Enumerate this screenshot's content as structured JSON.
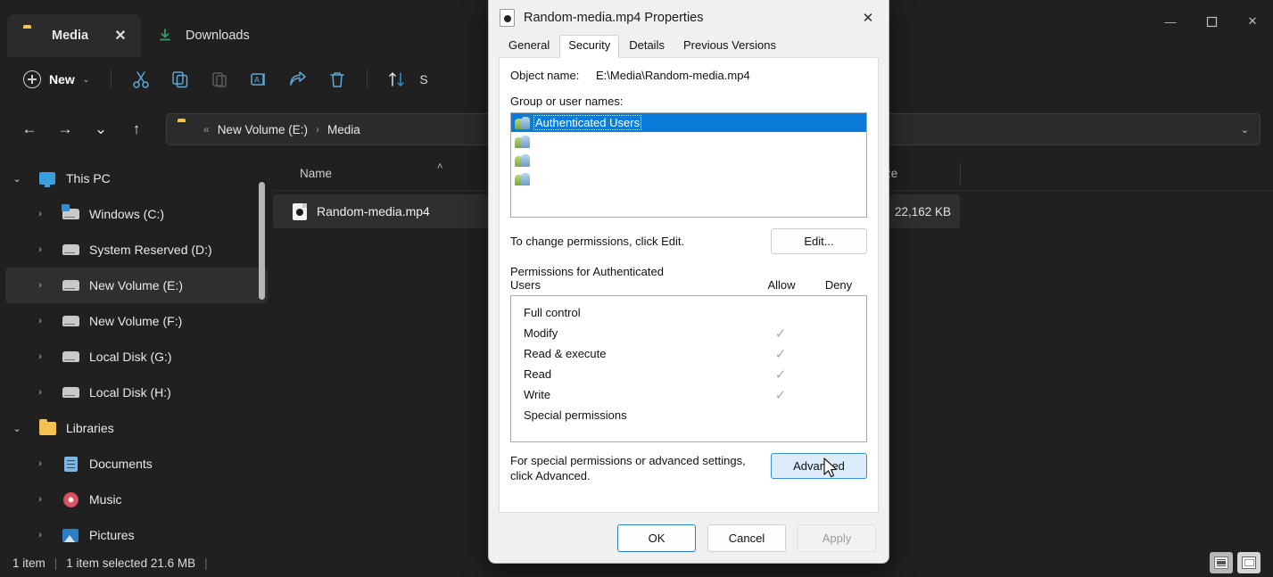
{
  "explorer": {
    "tabs": [
      {
        "label": "Media",
        "icon": "folder-icon",
        "active": true,
        "close": "✕"
      },
      {
        "label": "Downloads",
        "icon": "download-icon",
        "active": false
      }
    ],
    "window_controls": {
      "minimize": "—",
      "maximize": "❐",
      "close": "✕"
    },
    "toolbar": {
      "new_label": "New",
      "new_caret": "⌄",
      "sort_label": "S",
      "icons": [
        "cut-icon",
        "copy-icon",
        "paste-icon",
        "rename-icon",
        "share-icon",
        "delete-icon",
        "sort-icon"
      ]
    },
    "address": {
      "back": "←",
      "forward": "→",
      "recent": "⌄",
      "up": "↑",
      "chevrons": "«",
      "crumb1": "New Volume (E:)",
      "crumb_sep": "›",
      "crumb2": "Media",
      "dropdown": "⌄"
    },
    "nav": {
      "items": [
        {
          "label": "This PC",
          "icon": "pc-icon",
          "expanded": true,
          "indent": 0
        },
        {
          "label": "Windows (C:)",
          "icon": "drive-windows-icon",
          "expanded": false,
          "indent": 1
        },
        {
          "label": "System Reserved (D:)",
          "icon": "drive-icon",
          "expanded": false,
          "indent": 1
        },
        {
          "label": "New Volume (E:)",
          "icon": "drive-icon",
          "expanded": false,
          "indent": 1,
          "selected": true
        },
        {
          "label": "New Volume (F:)",
          "icon": "drive-icon",
          "expanded": false,
          "indent": 1
        },
        {
          "label": "Local Disk (G:)",
          "icon": "drive-icon",
          "expanded": false,
          "indent": 1
        },
        {
          "label": "Local Disk (H:)",
          "icon": "drive-icon",
          "expanded": false,
          "indent": 1
        },
        {
          "label": "Libraries",
          "icon": "folder-icon",
          "expanded": true,
          "indent": 0
        },
        {
          "label": "Documents",
          "icon": "documents-icon",
          "expanded": false,
          "indent": 1
        },
        {
          "label": "Music",
          "icon": "music-icon",
          "expanded": false,
          "indent": 1
        },
        {
          "label": "Pictures",
          "icon": "pictures-icon",
          "expanded": false,
          "indent": 1
        }
      ]
    },
    "filelist": {
      "columns": [
        "Name",
        "Size"
      ],
      "sort_indicator": "˄",
      "rows": [
        {
          "name": "Random-media.mp4",
          "size": "22,162 KB",
          "icon": "media-file-icon",
          "selected": true
        }
      ]
    },
    "statusbar": {
      "count": "1 item",
      "sep1": "|",
      "selected": "1 item selected  21.6 MB",
      "sep2": "|",
      "view_details": "details-view-icon",
      "view_tiles": "large-icons-view-icon"
    }
  },
  "dialog": {
    "title": "Random-media.mp4 Properties",
    "icon": "media-file-icon",
    "close": "✕",
    "tabs": [
      {
        "label": "General",
        "active": false
      },
      {
        "label": "Security",
        "active": true
      },
      {
        "label": "Details",
        "active": false
      },
      {
        "label": "Previous Versions",
        "active": false
      }
    ],
    "object_name_label": "Object name:",
    "object_name_value": "E:\\Media\\Random-media.mp4",
    "group_label": "Group or user names:",
    "group_list": [
      {
        "name": "Authenticated Users",
        "selected": true
      },
      {
        "name": "",
        "selected": false
      },
      {
        "name": "",
        "selected": false
      },
      {
        "name": "",
        "selected": false
      }
    ],
    "edit_hint": "To change permissions, click Edit.",
    "edit_button": "Edit...",
    "permissions_title": "Permissions for Authenticated\nUsers",
    "permissions_title_line1": "Permissions for Authenticated",
    "permissions_title_line2": "Users",
    "allow_header": "Allow",
    "deny_header": "Deny",
    "permissions": [
      {
        "name": "Full control",
        "allow": "",
        "deny": ""
      },
      {
        "name": "Modify",
        "allow": "✓",
        "deny": ""
      },
      {
        "name": "Read & execute",
        "allow": "✓",
        "deny": ""
      },
      {
        "name": "Read",
        "allow": "✓",
        "deny": ""
      },
      {
        "name": "Write",
        "allow": "✓",
        "deny": ""
      },
      {
        "name": "Special permissions",
        "allow": "",
        "deny": ""
      }
    ],
    "advanced_hint_line1": "For special permissions or advanced settings,",
    "advanced_hint_line2": "click Advanced.",
    "advanced_button": "Advanced",
    "ok_button": "OK",
    "cancel_button": "Cancel",
    "apply_button": "Apply"
  },
  "colors": {
    "accent_blue": "#0a7bd8",
    "hover_blue": "#dcecfa",
    "focus_border": "#2a7fc4",
    "folder_yellow": "#f5c24f",
    "toolbar_icon": "#5fa8d8"
  }
}
